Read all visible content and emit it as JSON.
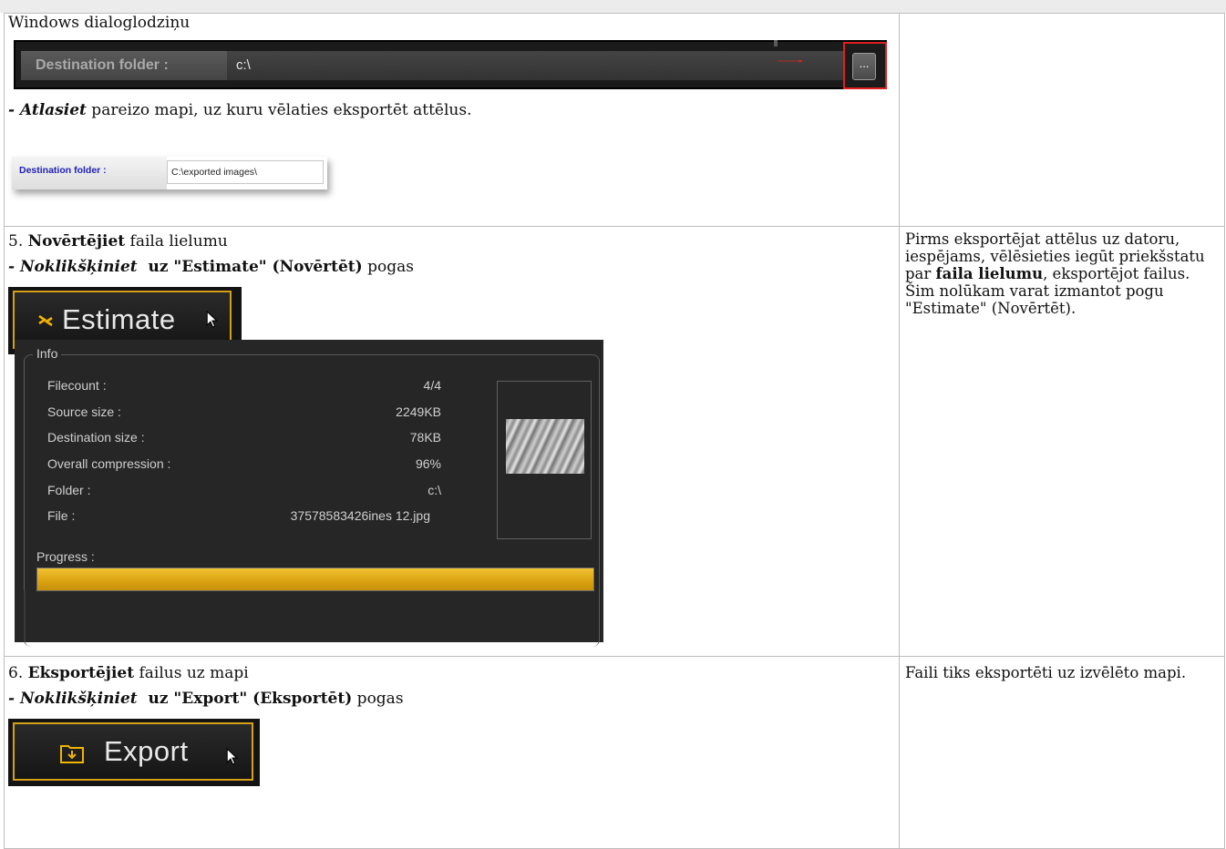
{
  "row1": {
    "caption": "Windows dialoglodziņu",
    "dest_label": "Destination folder :",
    "dest_value": "c:\\",
    "browse_label": "...",
    "instr_bold": "Atlasiet",
    "instr_rest": " pareizo mapi, uz kuru vēlaties eksportēt attēlus.",
    "small_dest_label": "Destination folder :",
    "small_dest_value": "C:\\exported images\\"
  },
  "row2": {
    "step_num": "5.",
    "step_bold": "Novērtējiet",
    "step_rest": " faila lielumu",
    "click_bold": "Noklikšķiniet",
    "click_quote": "uz \"Estimate\" (Novērtēt)",
    "click_rest": " pogas",
    "button_label": "Estimate",
    "info": {
      "title": "Info",
      "rows": [
        {
          "key": "Filecount :",
          "value": "4/4"
        },
        {
          "key": "Source size :",
          "value": "2249KB"
        },
        {
          "key": "Destination size :",
          "value": "78KB"
        },
        {
          "key": "Overall compression :",
          "value": "96%"
        },
        {
          "key": "Folder :",
          "value": "c:\\"
        },
        {
          "key": "File :",
          "value": "37578583426ines  12.jpg"
        }
      ],
      "progress_label": "Progress :",
      "progress": 1.0
    },
    "note_pre": "Pirms eksportējat attēlus uz datoru, iespējams, vēlēsieties iegūt priekšstatu par ",
    "note_bold": "faila lielumu",
    "note_post": ", eksportējot failus. Šim nolūkam varat izmantot pogu \"Estimate\" (Novērtēt)."
  },
  "row3": {
    "step_num": "6.",
    "step_bold": "Eksportējiet",
    "step_rest": " failus uz mapi",
    "click_bold": "Noklikšķiniet",
    "click_quote": "uz \"Export\" (Eksportēt)",
    "click_rest": " pogas",
    "button_label": "Export",
    "note": "Faili tiks eksportēti uz izvēlēto mapi."
  },
  "colors": {
    "button_border": "#d4a017",
    "progress": "#e0ac18",
    "arrow": "#e02020",
    "folder_icon": "#f0b400"
  },
  "icons": [
    "estimate-icon",
    "export-folder-icon",
    "cursor-arrow-icon",
    "red-arrow-icon"
  ]
}
